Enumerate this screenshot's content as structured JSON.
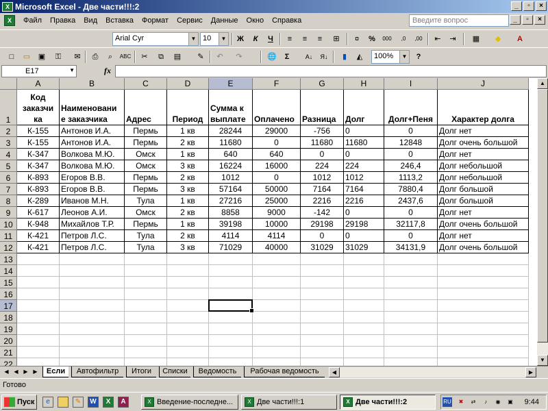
{
  "window": {
    "title": "Microsoft Excel - Две части!!!:2"
  },
  "menu": {
    "items": [
      "Файл",
      "Правка",
      "Вид",
      "Вставка",
      "Формат",
      "Сервис",
      "Данные",
      "Окно",
      "Справка"
    ],
    "ask_placeholder": "Введите вопрос"
  },
  "format_toolbar": {
    "font": "Arial Cyr",
    "size": "10",
    "bold": "Ж",
    "italic": "К",
    "underline": "Ч",
    "percent": "%",
    "thousands": "000",
    "inc_decimals": ",0",
    "dec_decimals": ",00"
  },
  "std_toolbar": {
    "zoom": "100%",
    "sigma": "Σ"
  },
  "formula_bar": {
    "name_box": "E17",
    "fx": "fx",
    "content": ""
  },
  "grid": {
    "columns": [
      "A",
      "B",
      "C",
      "D",
      "E",
      "F",
      "G",
      "H",
      "I",
      "J"
    ],
    "active_column": "E",
    "active_row": "17",
    "header_row": [
      "Код заказчика",
      "Наименование заказчика",
      "Адрес",
      "Период",
      "Сумма к выплате",
      "Оплачено",
      "Разница",
      "Долг",
      "Долг+Пеня",
      "Характер долга"
    ],
    "header_row_lines": [
      [
        "Код",
        "заказчи",
        "ка"
      ],
      [
        "Наименовани",
        "е заказчика"
      ],
      [
        "Адрес"
      ],
      [
        "Период"
      ],
      [
        "Сумма к",
        "выплате"
      ],
      [
        "Оплачено"
      ],
      [
        "Разница"
      ],
      [
        "Долг"
      ],
      [
        "Долг+Пеня"
      ],
      [
        "Характер долга"
      ]
    ],
    "rows": [
      [
        "К-155",
        "Антонов И.А.",
        "Пермь",
        "1 кв",
        "28244",
        "29000",
        "-756",
        "0",
        "0",
        "Долг нет"
      ],
      [
        "К-155",
        "Антонов И.А.",
        "Пермь",
        "2 кв",
        "11680",
        "0",
        "11680",
        "11680",
        "12848",
        "Долг очень большой"
      ],
      [
        "К-347",
        "Волкова М.Ю.",
        "Омск",
        "1 кв",
        "640",
        "640",
        "0",
        "0",
        "0",
        "Долг нет"
      ],
      [
        "К-347",
        "Волкова М.Ю.",
        "Омск",
        "3 кв",
        "16224",
        "16000",
        "224",
        "224",
        "246,4",
        "Долг небольшой"
      ],
      [
        "К-893",
        "Егоров В.В.",
        "Пермь",
        "2 кв",
        "1012",
        "0",
        "1012",
        "1012",
        "1113,2",
        "Долг небольшой"
      ],
      [
        "К-893",
        "Егоров В.В.",
        "Пермь",
        "3 кв",
        "57164",
        "50000",
        "7164",
        "7164",
        "7880,4",
        "Долг большой"
      ],
      [
        "К-289",
        "Иванов М.Н.",
        "Тула",
        "1 кв",
        "27216",
        "25000",
        "2216",
        "2216",
        "2437,6",
        "Долг большой"
      ],
      [
        "К-617",
        "Леонов А.И.",
        "Омск",
        "2 кв",
        "8858",
        "9000",
        "-142",
        "0",
        "0",
        "Долг нет"
      ],
      [
        "К-948",
        "Михайлов Т.Р.",
        "Пермь",
        "1 кв",
        "39198",
        "10000",
        "29198",
        "29198",
        "32117,8",
        "Долг очень большой"
      ],
      [
        "К-421",
        "Петров Л.С.",
        "Тула",
        "2 кв",
        "4114",
        "4114",
        "0",
        "0",
        "0",
        "Долг нет"
      ],
      [
        "К-421",
        "Петров Л.С.",
        "Тула",
        "3 кв",
        "71029",
        "40000",
        "31029",
        "31029",
        "34131,9",
        "Долг очень большой"
      ]
    ],
    "row_numbers": [
      "1",
      "2",
      "3",
      "4",
      "5",
      "6",
      "7",
      "8",
      "9",
      "10",
      "11",
      "12",
      "13",
      "14",
      "15",
      "16",
      "17",
      "18",
      "19",
      "20",
      "21",
      "22"
    ]
  },
  "sheet_tabs": {
    "tabs": [
      "Если",
      "Автофильтр",
      "Итоги",
      "Списки",
      "Ведомость",
      "Рабочая ведомость"
    ],
    "active": "Если"
  },
  "status": {
    "text": "Готово"
  },
  "taskbar": {
    "start": "Пуск",
    "tasks": [
      "Введение-последне...",
      "Две части!!!:1",
      "Две части!!!:2"
    ],
    "active_task": "Две части!!!:2",
    "lang": "RU",
    "clock": "9:44"
  }
}
